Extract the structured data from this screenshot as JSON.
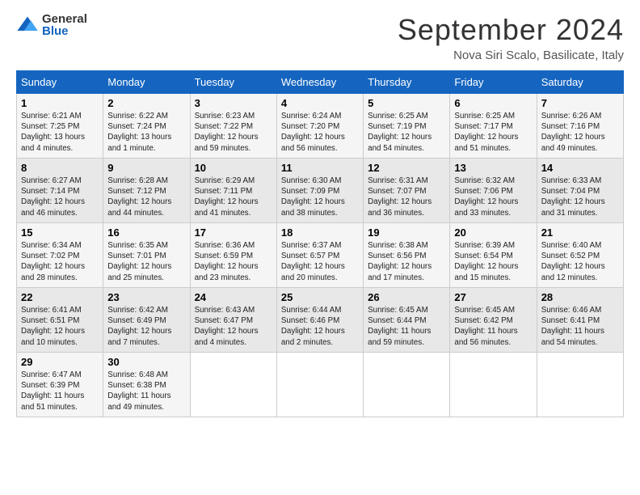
{
  "logo": {
    "general": "General",
    "blue": "Blue"
  },
  "title": "September 2024",
  "location": "Nova Siri Scalo, Basilicate, Italy",
  "days_of_week": [
    "Sunday",
    "Monday",
    "Tuesday",
    "Wednesday",
    "Thursday",
    "Friday",
    "Saturday"
  ],
  "weeks": [
    [
      {
        "day": 1,
        "sunrise": "6:21 AM",
        "sunset": "7:25 PM",
        "daylight": "13 hours and 4 minutes"
      },
      {
        "day": 2,
        "sunrise": "6:22 AM",
        "sunset": "7:24 PM",
        "daylight": "13 hours and 1 minute"
      },
      {
        "day": 3,
        "sunrise": "6:23 AM",
        "sunset": "7:22 PM",
        "daylight": "12 hours and 59 minutes"
      },
      {
        "day": 4,
        "sunrise": "6:24 AM",
        "sunset": "7:20 PM",
        "daylight": "12 hours and 56 minutes"
      },
      {
        "day": 5,
        "sunrise": "6:25 AM",
        "sunset": "7:19 PM",
        "daylight": "12 hours and 54 minutes"
      },
      {
        "day": 6,
        "sunrise": "6:25 AM",
        "sunset": "7:17 PM",
        "daylight": "12 hours and 51 minutes"
      },
      {
        "day": 7,
        "sunrise": "6:26 AM",
        "sunset": "7:16 PM",
        "daylight": "12 hours and 49 minutes"
      }
    ],
    [
      {
        "day": 8,
        "sunrise": "6:27 AM",
        "sunset": "7:14 PM",
        "daylight": "12 hours and 46 minutes"
      },
      {
        "day": 9,
        "sunrise": "6:28 AM",
        "sunset": "7:12 PM",
        "daylight": "12 hours and 44 minutes"
      },
      {
        "day": 10,
        "sunrise": "6:29 AM",
        "sunset": "7:11 PM",
        "daylight": "12 hours and 41 minutes"
      },
      {
        "day": 11,
        "sunrise": "6:30 AM",
        "sunset": "7:09 PM",
        "daylight": "12 hours and 38 minutes"
      },
      {
        "day": 12,
        "sunrise": "6:31 AM",
        "sunset": "7:07 PM",
        "daylight": "12 hours and 36 minutes"
      },
      {
        "day": 13,
        "sunrise": "6:32 AM",
        "sunset": "7:06 PM",
        "daylight": "12 hours and 33 minutes"
      },
      {
        "day": 14,
        "sunrise": "6:33 AM",
        "sunset": "7:04 PM",
        "daylight": "12 hours and 31 minutes"
      }
    ],
    [
      {
        "day": 15,
        "sunrise": "6:34 AM",
        "sunset": "7:02 PM",
        "daylight": "12 hours and 28 minutes"
      },
      {
        "day": 16,
        "sunrise": "6:35 AM",
        "sunset": "7:01 PM",
        "daylight": "12 hours and 25 minutes"
      },
      {
        "day": 17,
        "sunrise": "6:36 AM",
        "sunset": "6:59 PM",
        "daylight": "12 hours and 23 minutes"
      },
      {
        "day": 18,
        "sunrise": "6:37 AM",
        "sunset": "6:57 PM",
        "daylight": "12 hours and 20 minutes"
      },
      {
        "day": 19,
        "sunrise": "6:38 AM",
        "sunset": "6:56 PM",
        "daylight": "12 hours and 17 minutes"
      },
      {
        "day": 20,
        "sunrise": "6:39 AM",
        "sunset": "6:54 PM",
        "daylight": "12 hours and 15 minutes"
      },
      {
        "day": 21,
        "sunrise": "6:40 AM",
        "sunset": "6:52 PM",
        "daylight": "12 hours and 12 minutes"
      }
    ],
    [
      {
        "day": 22,
        "sunrise": "6:41 AM",
        "sunset": "6:51 PM",
        "daylight": "12 hours and 10 minutes"
      },
      {
        "day": 23,
        "sunrise": "6:42 AM",
        "sunset": "6:49 PM",
        "daylight": "12 hours and 7 minutes"
      },
      {
        "day": 24,
        "sunrise": "6:43 AM",
        "sunset": "6:47 PM",
        "daylight": "12 hours and 4 minutes"
      },
      {
        "day": 25,
        "sunrise": "6:44 AM",
        "sunset": "6:46 PM",
        "daylight": "12 hours and 2 minutes"
      },
      {
        "day": 26,
        "sunrise": "6:45 AM",
        "sunset": "6:44 PM",
        "daylight": "11 hours and 59 minutes"
      },
      {
        "day": 27,
        "sunrise": "6:45 AM",
        "sunset": "6:42 PM",
        "daylight": "11 hours and 56 minutes"
      },
      {
        "day": 28,
        "sunrise": "6:46 AM",
        "sunset": "6:41 PM",
        "daylight": "11 hours and 54 minutes"
      }
    ],
    [
      {
        "day": 29,
        "sunrise": "6:47 AM",
        "sunset": "6:39 PM",
        "daylight": "11 hours and 51 minutes"
      },
      {
        "day": 30,
        "sunrise": "6:48 AM",
        "sunset": "6:38 PM",
        "daylight": "11 hours and 49 minutes"
      },
      null,
      null,
      null,
      null,
      null
    ]
  ]
}
